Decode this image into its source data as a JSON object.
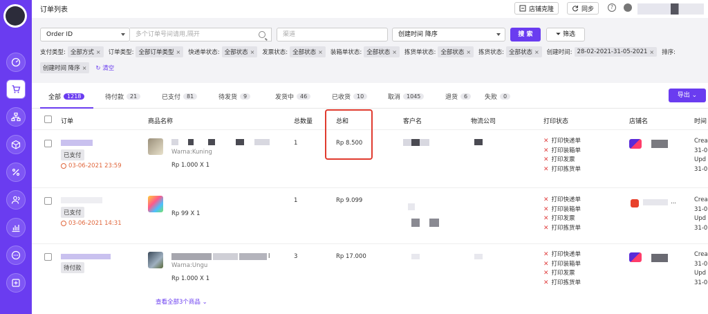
{
  "header": {
    "title": "订单列表",
    "store_clone_label": "店铺克隆",
    "sync_label": "同步",
    "help_label": "?"
  },
  "search": {
    "field_select": "Order ID",
    "placeholder": "多个订单号间请用,隔开",
    "channel_placeholder": "渠道",
    "sort_select": "创建时间 降序",
    "search_label": "搜 索",
    "filter_label": "筛选"
  },
  "filters": [
    {
      "label": "支付类型:",
      "chip": "全部方式"
    },
    {
      "label": "订单类型:",
      "chip": "全部订单类型"
    },
    {
      "label": "快递单状态:",
      "chip": "全部状态"
    },
    {
      "label": "发票状态:",
      "chip": "全部状态"
    },
    {
      "label": "装箱单状态:",
      "chip": "全部状态"
    },
    {
      "label": "拣货单状态:",
      "chip": "全部状态"
    },
    {
      "label": "拣货状态:",
      "chip": "全部状态"
    },
    {
      "label": "创建时间:",
      "chip": "28-02-2021-31-05-2021"
    }
  ],
  "sort_label": "排序:",
  "sort_chip": "创建时间 降序",
  "clear_label": "清空",
  "tabs": [
    {
      "label": "全部",
      "count": "1218"
    },
    {
      "label": "待付款",
      "count": "21"
    },
    {
      "label": "已支付",
      "count": "81"
    },
    {
      "label": "待发货",
      "count": "9"
    },
    {
      "label": "发货中",
      "count": "46"
    },
    {
      "label": "已收货",
      "count": "10"
    },
    {
      "label": "取消",
      "count": "1045"
    },
    {
      "label": "退货",
      "count": "6"
    },
    {
      "label": "失败",
      "count": "0"
    }
  ],
  "export_label": "导出",
  "columns": [
    "订单",
    "商品名称",
    "总数量",
    "总和",
    "客户名",
    "物流公司",
    "打印状态",
    "店铺名",
    "时间"
  ],
  "print_labels": [
    "打印快递单",
    "打印装箱单",
    "打印发票",
    "打印拣货单"
  ],
  "orders": [
    {
      "status": "已支付",
      "date": "03-06-2021 23:59",
      "variant": "Warna:Kuning",
      "price_qty": "Rp 1.000 X 1",
      "quantity": "1",
      "total": "Rp 8.500",
      "times": [
        "Crea",
        "31-0",
        "Upd",
        "31-0"
      ]
    },
    {
      "status": "已支付",
      "date": "03-06-2021 14:31",
      "variant": "",
      "price_qty": "Rp 99 X 1",
      "quantity": "1",
      "total": "Rp 9.099",
      "times": [
        "Crea",
        "31-0",
        "Upd",
        "31-0"
      ],
      "store_suffix": "..."
    },
    {
      "status": "待付款",
      "date": "",
      "variant": "Warna:Ungu",
      "price_qty": "Rp 1.000 X 1",
      "quantity": "3",
      "total": "Rp 17.000",
      "times": [
        "Crea",
        "31-0",
        "Upd",
        "31-0"
      ],
      "product_suffix": "l"
    }
  ],
  "view_all_label": "查看全部3个商品",
  "colors": {
    "accent": "#6a3cf0",
    "warn": "#e0653a",
    "error": "#e04040"
  }
}
